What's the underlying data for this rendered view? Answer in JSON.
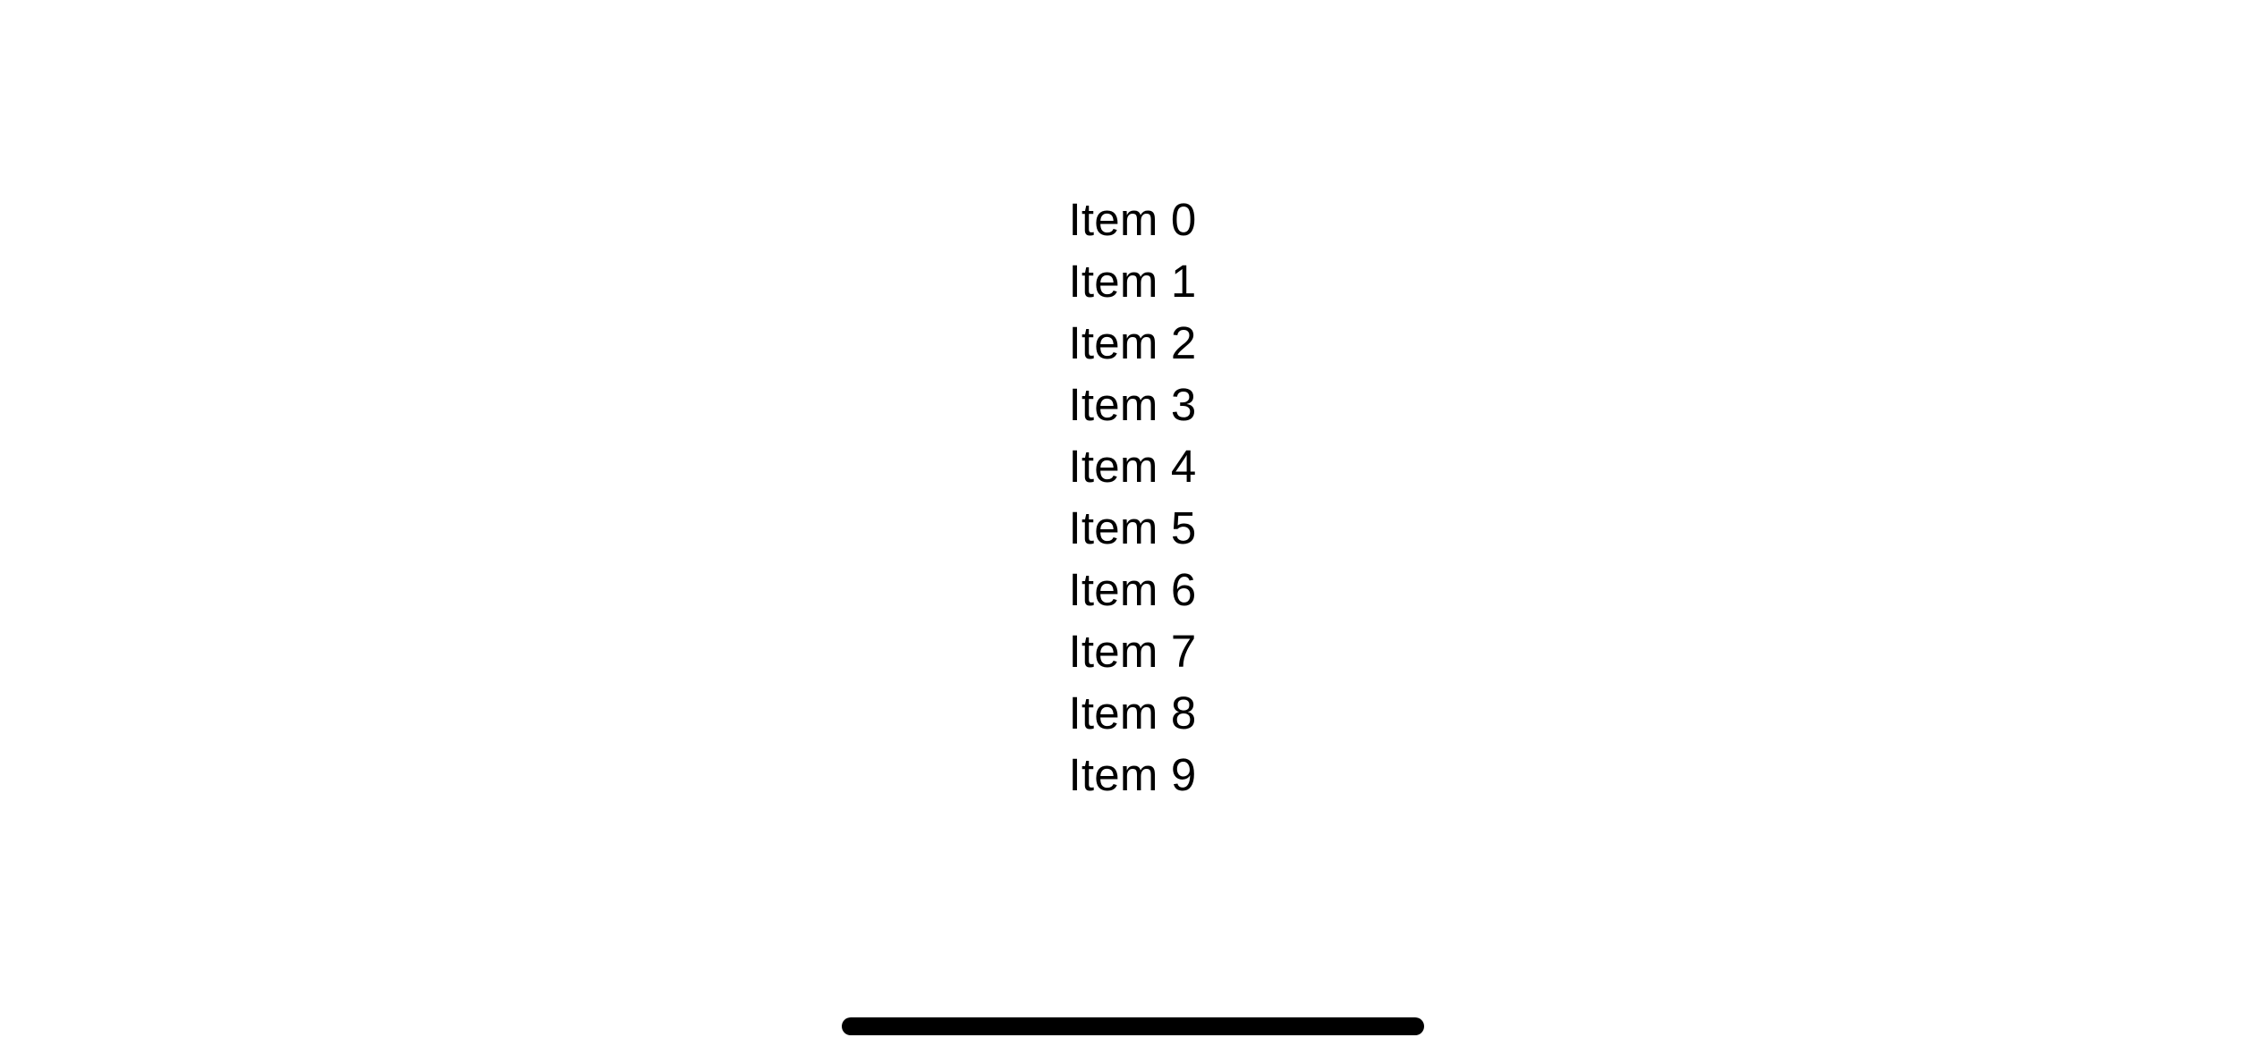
{
  "list": {
    "items": [
      {
        "label": "Item 0"
      },
      {
        "label": "Item 1"
      },
      {
        "label": "Item 2"
      },
      {
        "label": "Item 3"
      },
      {
        "label": "Item 4"
      },
      {
        "label": "Item 5"
      },
      {
        "label": "Item 6"
      },
      {
        "label": "Item 7"
      },
      {
        "label": "Item 8"
      },
      {
        "label": "Item 9"
      }
    ]
  },
  "colors": {
    "background": "#ffffff",
    "text": "#000000",
    "home_indicator": "#000000"
  }
}
